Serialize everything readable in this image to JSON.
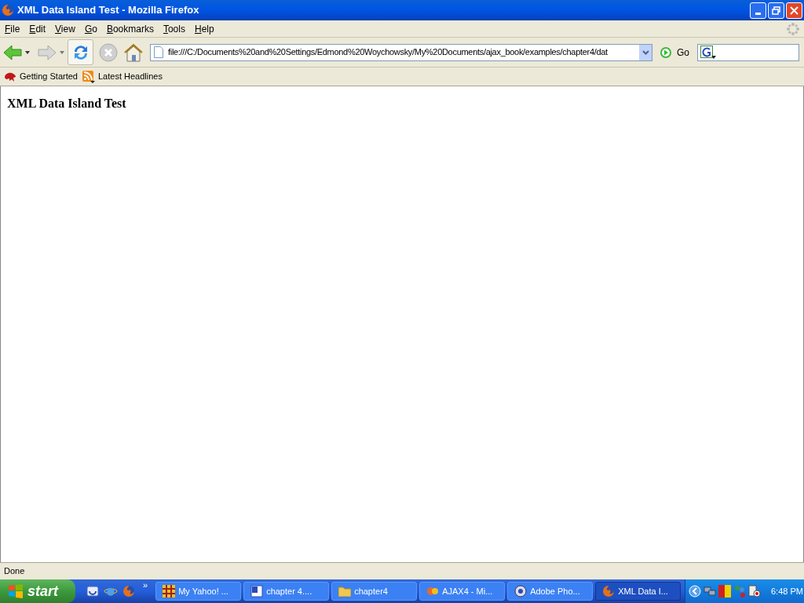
{
  "window": {
    "title": "XML Data Island Test - Mozilla Firefox"
  },
  "menu": [
    "File",
    "Edit",
    "View",
    "Go",
    "Bookmarks",
    "Tools",
    "Help"
  ],
  "address_bar": {
    "value": "file:///C:/Documents%20and%20Settings/Edmond%20Woychowsky/My%20Documents/ajax_book/examples/chapter4/dat"
  },
  "go_button": "Go",
  "bookmarks": [
    {
      "label": "Getting Started",
      "kind": "page"
    },
    {
      "label": "Latest Headlines",
      "kind": "feed"
    }
  ],
  "page": {
    "heading": "XML Data Island Test"
  },
  "status_bar": "Done",
  "taskbar": {
    "start": "start",
    "quick_launch_more": "»",
    "tasks": [
      {
        "label": "My Yahoo! ...",
        "kind": "yahoo",
        "selected": false
      },
      {
        "label": "chapter 4....",
        "kind": "word",
        "selected": false
      },
      {
        "label": "chapter4",
        "kind": "folder",
        "selected": false
      },
      {
        "label": "AJAX4 - Mi...",
        "kind": "app",
        "selected": false
      },
      {
        "label": "Adobe Pho...",
        "kind": "photo",
        "selected": false
      },
      {
        "label": "XML Data I...",
        "kind": "firefox",
        "selected": true
      }
    ],
    "clock": "6:48 PM"
  }
}
